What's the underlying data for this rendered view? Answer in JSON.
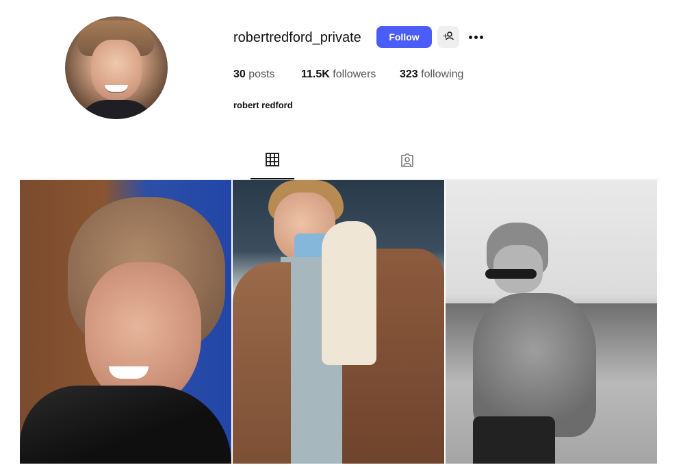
{
  "profile": {
    "username": "robertredford_private",
    "full_name": "robert redford",
    "follow_label": "Follow",
    "stats": {
      "posts_count": "30",
      "posts_label": "posts",
      "followers_count": "11.5K",
      "followers_label": "followers",
      "following_count": "323",
      "following_label": "following"
    }
  },
  "icons": {
    "suggest": "add-person-icon",
    "more": "more-options-icon",
    "posts_tab": "grid-icon",
    "tagged_tab": "tagged-icon"
  },
  "colors": {
    "accent": "#4a5df9",
    "divider": "#dbdbdb"
  },
  "posts": [
    {
      "kind": "photo"
    },
    {
      "kind": "photo"
    },
    {
      "kind": "photo"
    }
  ]
}
